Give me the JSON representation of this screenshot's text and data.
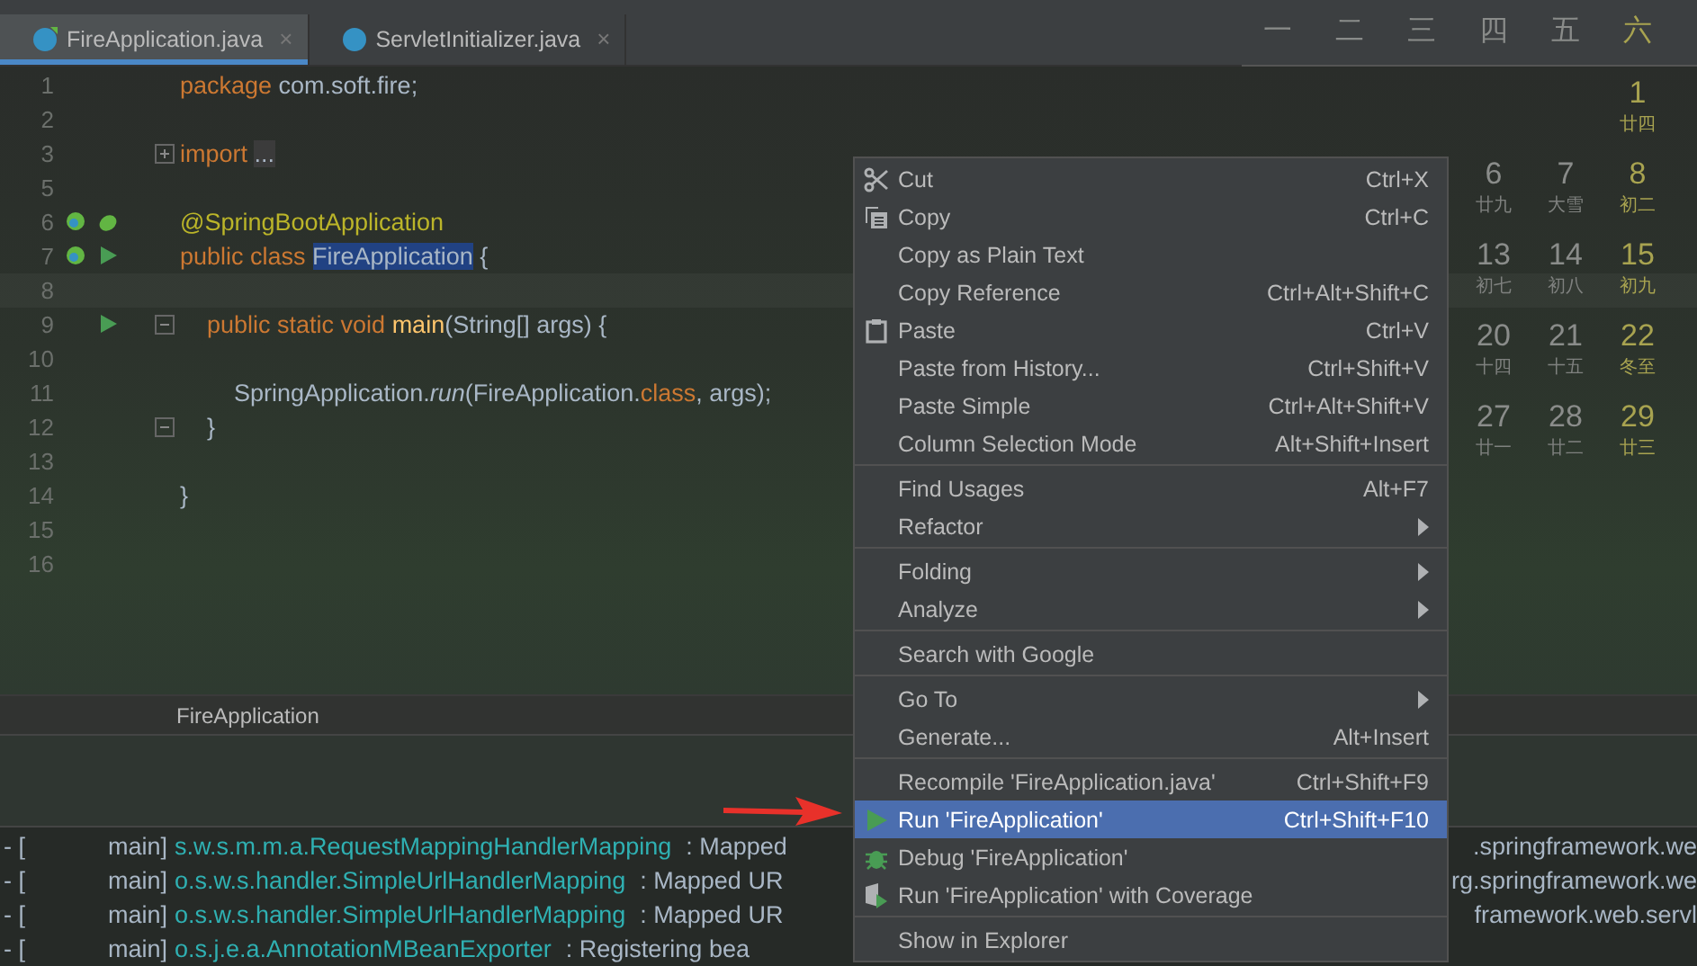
{
  "tabs": [
    {
      "label": "FireApplication.java",
      "selected": true,
      "close": "×"
    },
    {
      "label": "ServletInitializer.java",
      "selected": false,
      "close": "×"
    }
  ],
  "editor": {
    "lines": [
      {
        "num": "1",
        "tokens": [
          {
            "text": "package ",
            "kind": "keyword"
          },
          {
            "text": "com.soft.fire;",
            "kind": "plain"
          }
        ]
      },
      {
        "num": "2"
      },
      {
        "num": "3",
        "collapsed": true,
        "tokens": [
          {
            "text": "import ",
            "kind": "keyword"
          },
          {
            "text": "...",
            "kind": "folded"
          }
        ]
      },
      {
        "num": "5"
      },
      {
        "num": "6",
        "tokens": [
          {
            "text": "@SpringBootApplication",
            "kind": "annotation"
          }
        ]
      },
      {
        "num": "7",
        "tokens": [
          {
            "text": "public class ",
            "kind": "keyword"
          },
          {
            "text": "FireApplication",
            "kind": "selection"
          },
          {
            "text": " {",
            "kind": "plain"
          }
        ]
      },
      {
        "num": "8"
      },
      {
        "num": "9",
        "collapsed": false,
        "tokens": [
          {
            "text": "    public static void ",
            "kind": "keyword"
          },
          {
            "text": "main",
            "kind": "method"
          },
          {
            "text": "(String[] args) {",
            "kind": "plain"
          }
        ]
      },
      {
        "num": "10"
      },
      {
        "num": "11",
        "tokens": [
          {
            "text": "        SpringApplication.",
            "kind": "plain"
          },
          {
            "text": "run",
            "kind": "static"
          },
          {
            "text": "(FireApplication.",
            "kind": "plain"
          },
          {
            "text": "class",
            "kind": "keyword"
          },
          {
            "text": ", args);",
            "kind": "plain"
          }
        ]
      },
      {
        "num": "12",
        "collapsed": false,
        "tokens": [
          {
            "text": "    }",
            "kind": "plain"
          }
        ]
      },
      {
        "num": "13"
      },
      {
        "num": "14",
        "tokens": [
          {
            "text": "}",
            "kind": "plain"
          }
        ]
      },
      {
        "num": "15"
      },
      {
        "num": "16"
      }
    ],
    "breadcrumb": "FireApplication"
  },
  "calendar": {
    "headers": [
      {
        "label": "一",
        "weekend": false
      },
      {
        "label": "二",
        "weekend": false
      },
      {
        "label": "三",
        "weekend": false
      },
      {
        "label": "四",
        "weekend": false
      },
      {
        "label": "五",
        "weekend": false
      },
      {
        "label": "六",
        "weekend": true
      }
    ],
    "weeks": [
      [
        {
          "day": "1",
          "lunar": "廿四"
        }
      ],
      [
        {
          "day": "6",
          "lunar": "廿九"
        },
        {
          "day": "7",
          "lunar": "大雪"
        },
        {
          "day": "8",
          "lunar": "初二"
        }
      ],
      [
        {
          "day": "13",
          "lunar": "初七"
        },
        {
          "day": "14",
          "lunar": "初八"
        },
        {
          "day": "15",
          "lunar": "初九"
        }
      ],
      [
        {
          "day": "20",
          "lunar": "十四"
        },
        {
          "day": "21",
          "lunar": "十五"
        },
        {
          "day": "22",
          "lunar": "冬至"
        }
      ],
      [
        {
          "day": "27",
          "lunar": "廿一"
        },
        {
          "day": "28",
          "lunar": "廿二"
        },
        {
          "day": "29",
          "lunar": "廿三"
        }
      ]
    ]
  },
  "console": [
    {
      "prefix": "- [",
      "thread": "main]",
      "logger": "s.w.s.m.m.a.RequestMappingHandlerMapping",
      "message": ": Mapped",
      "tail": ".springframework.we"
    },
    {
      "prefix": "- [",
      "thread": "main]",
      "logger": "o.s.w.s.handler.SimpleUrlHandlerMapping",
      "message": ": Mapped UR",
      "tail": "rg.springframework.we"
    },
    {
      "prefix": "- [",
      "thread": "main]",
      "logger": "o.s.w.s.handler.SimpleUrlHandlerMapping",
      "message": ": Mapped UR",
      "tail": "framework.web.servl"
    },
    {
      "prefix": "- [",
      "thread": "main]",
      "logger": "o.s.j.e.a.AnnotationMBeanExporter",
      "message": ": Registering bea"
    }
  ],
  "context_menu": [
    [
      {
        "label": "Cut",
        "shortcut": "Ctrl+X",
        "submenu": false,
        "selected": false
      },
      {
        "label": "Copy",
        "shortcut": "Ctrl+C",
        "submenu": false,
        "selected": false
      },
      {
        "label": "Copy as Plain Text",
        "submenu": false,
        "selected": false
      },
      {
        "label": "Copy Reference",
        "shortcut": "Ctrl+Alt+Shift+C",
        "submenu": false,
        "selected": false
      },
      {
        "label": "Paste",
        "shortcut": "Ctrl+V",
        "submenu": false,
        "selected": false
      },
      {
        "label": "Paste from History...",
        "shortcut": "Ctrl+Shift+V",
        "submenu": false,
        "selected": false
      },
      {
        "label": "Paste Simple",
        "shortcut": "Ctrl+Alt+Shift+V",
        "submenu": false,
        "selected": false
      },
      {
        "label": "Column Selection Mode",
        "shortcut": "Alt+Shift+Insert",
        "submenu": false,
        "selected": false
      }
    ],
    [
      {
        "label": "Find Usages",
        "shortcut": "Alt+F7",
        "submenu": false,
        "selected": false
      },
      {
        "label": "Refactor",
        "submenu": true,
        "selected": false
      }
    ],
    [
      {
        "label": "Folding",
        "submenu": true,
        "selected": false
      },
      {
        "label": "Analyze",
        "submenu": true,
        "selected": false
      }
    ],
    [
      {
        "label": "Search with Google",
        "submenu": false,
        "selected": false
      }
    ],
    [
      {
        "label": "Go To",
        "submenu": true,
        "selected": false
      },
      {
        "label": "Generate...",
        "shortcut": "Alt+Insert",
        "submenu": false,
        "selected": false
      }
    ],
    [
      {
        "label": "Recompile 'FireApplication.java'",
        "shortcut": "Ctrl+Shift+F9",
        "submenu": false,
        "selected": false
      },
      {
        "label": "Run 'FireApplication'",
        "shortcut": "Ctrl+Shift+F10",
        "submenu": false,
        "selected": true
      },
      {
        "label": "Debug 'FireApplication'",
        "submenu": false,
        "selected": false
      },
      {
        "label": "Run 'FireApplication' with Coverage",
        "submenu": false,
        "selected": false
      }
    ],
    [
      {
        "label": "Show in Explorer",
        "submenu": false,
        "selected": false
      }
    ]
  ]
}
